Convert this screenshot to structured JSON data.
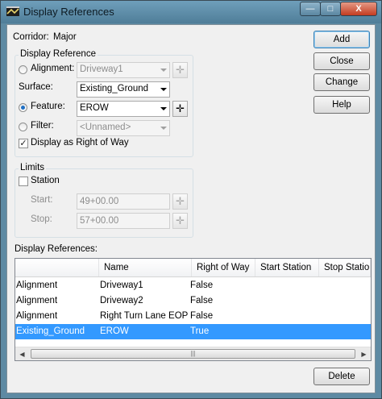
{
  "window": {
    "title": "Display References",
    "controls": {
      "minimize": "—",
      "maximize": "□",
      "close": "X"
    }
  },
  "corridor": {
    "label": "Corridor:",
    "value": "Major"
  },
  "display_reference": {
    "legend": "Display Reference",
    "alignment": {
      "label": "Alignment:",
      "value": "Driveway1",
      "selected": false,
      "enabled": false
    },
    "surface": {
      "label": "Surface:",
      "value": "Existing_Ground"
    },
    "feature": {
      "label": "Feature:",
      "value": "EROW",
      "selected": true
    },
    "filter": {
      "label": "Filter:",
      "value": "<Unnamed>",
      "selected": false,
      "enabled": false
    },
    "right_of_way": {
      "label": "Display as Right of Way",
      "checked": true
    }
  },
  "limits": {
    "legend": "Limits",
    "station": {
      "label": "Station",
      "checked": false
    },
    "start": {
      "label": "Start:",
      "value": "49+00.00"
    },
    "stop": {
      "label": "Stop:",
      "value": "57+00.00"
    }
  },
  "buttons": {
    "add": "Add",
    "close": "Close",
    "change": "Change",
    "help": "Help",
    "delete": "Delete"
  },
  "pick_icon": "crosshair-icon",
  "list": {
    "label": "Display References:",
    "columns": [
      "",
      "Name",
      "Right of Way",
      "Start Station",
      "Stop Station"
    ],
    "rows": [
      [
        "Alignment",
        "Driveway1",
        "False",
        "",
        ""
      ],
      [
        "Alignment",
        "Driveway2",
        "False",
        "",
        ""
      ],
      [
        "Alignment",
        "Right Turn Lane EOP",
        "False",
        "",
        ""
      ],
      [
        "Existing_Ground",
        "EROW",
        "True",
        "",
        ""
      ]
    ],
    "selected_row": 3
  },
  "colors": {
    "selection": "#3399ff",
    "titlebar": "#5e8aa3",
    "close_button": "#c43b20"
  }
}
